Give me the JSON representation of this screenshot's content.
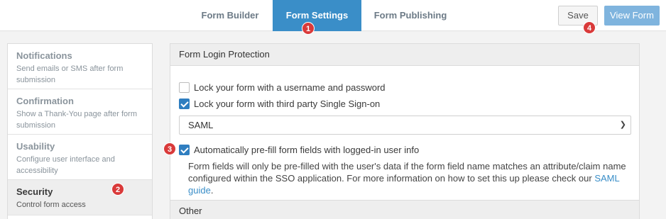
{
  "header": {
    "tabs": [
      {
        "label": "Form Builder"
      },
      {
        "label": "Form Settings"
      },
      {
        "label": "Form Publishing"
      }
    ],
    "save_label": "Save",
    "view_label": "View Form"
  },
  "badges": [
    "1",
    "2",
    "3",
    "4"
  ],
  "sidebar": {
    "items": [
      {
        "title": "Notifications",
        "desc": "Send emails or SMS after form submission"
      },
      {
        "title": "Confirmation",
        "desc": "Show a Thank-You page after form submission"
      },
      {
        "title": "Usability",
        "desc": "Configure user interface and accessibility"
      },
      {
        "title": "Security",
        "desc": "Control form access"
      }
    ]
  },
  "main": {
    "section_title": "Form Login Protection",
    "options": {
      "lock_password": {
        "label": "Lock your form with a username and password",
        "checked": false
      },
      "lock_sso": {
        "label": "Lock your form with third party Single Sign-on",
        "checked": true
      },
      "prefill": {
        "label": "Automatically pre-fill form fields with logged-in user info",
        "checked": true
      }
    },
    "sso_select": {
      "value": "SAML"
    },
    "note_text": "Form fields will only be pre-filled with the user's data if the form field name matches an attribute/claim name configured within the SSO application. For more information on how to set this up please check our ",
    "note_link": "SAML guide",
    "note_end": ".",
    "other_title": "Other"
  },
  "colors": {
    "accent": "#3a8ec8",
    "badge": "#d93a3a"
  }
}
